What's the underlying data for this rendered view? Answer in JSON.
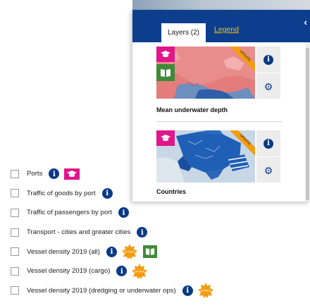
{
  "panel": {
    "tabs": [
      {
        "label": "Layers (2)",
        "active": true
      },
      {
        "label": "Legend",
        "active": false
      }
    ],
    "collapse_icon": "chevron-left-icon",
    "cards": [
      {
        "title": "Mean underwater depth",
        "badges": [
          "graduation-cap-icon",
          "book-icon",
          "update-ribbon"
        ],
        "buttons": [
          "info-icon",
          "gear-icon"
        ]
      },
      {
        "title": "Countries",
        "badges": [
          "graduation-cap-icon",
          "update-ribbon"
        ],
        "buttons": [
          "info-icon",
          "gear-icon"
        ]
      }
    ]
  },
  "layer_list": [
    {
      "label": "Ports",
      "checked": false,
      "icons": [
        "info-icon",
        "graduation-cap-icon"
      ]
    },
    {
      "label": "Traffic of goods by port",
      "checked": false,
      "icons": [
        "info-icon"
      ]
    },
    {
      "label": "Traffic of passengers by port",
      "checked": false,
      "icons": [
        "info-icon"
      ]
    },
    {
      "label": "Transport - cities and greater cities",
      "checked": false,
      "icons": [
        "info-icon"
      ]
    },
    {
      "label": "Vessel density 2019 (all)",
      "checked": false,
      "icons": [
        "info-icon",
        "update-badge-icon",
        "book-icon"
      ]
    },
    {
      "label": "Vessel density 2019 (cargo)",
      "checked": false,
      "icons": [
        "info-icon",
        "update-badge-icon"
      ]
    },
    {
      "label": "Vessel density 2019 (dredging or underwater ops)",
      "checked": false,
      "icons": [
        "info-icon",
        "update-badge-icon"
      ]
    }
  ],
  "colors": {
    "header_blue": "#0d3e8e",
    "legend_link": "#f1c400",
    "info_blue": "#0a3a86",
    "education_pink": "#e0168a",
    "book_green": "#3f8a36",
    "update_orange": "#f39c12"
  }
}
